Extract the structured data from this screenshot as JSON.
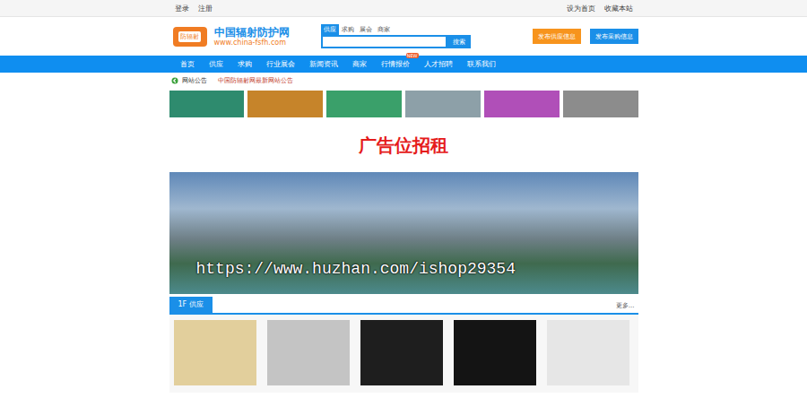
{
  "topbar": {
    "left": [
      "登录",
      "注册"
    ],
    "right": [
      "设为首页",
      "收藏本站"
    ]
  },
  "logo": {
    "badge": "防辐射",
    "title": "中国辐射防护网",
    "url": "www.china-fsfh.com"
  },
  "search": {
    "tabs": [
      {
        "label": "供应",
        "selected": true
      },
      {
        "label": "求购",
        "selected": false
      },
      {
        "label": "展会",
        "selected": false
      },
      {
        "label": "商家",
        "selected": false
      }
    ],
    "placeholder": "",
    "button": "搜索"
  },
  "actions": [
    {
      "label": "发布供应信息",
      "color": "#f7941d"
    },
    {
      "label": "发布采购信息",
      "color": "#1a8fe8"
    }
  ],
  "nav": [
    {
      "label": "首页"
    },
    {
      "label": "供应"
    },
    {
      "label": "求购"
    },
    {
      "label": "行业展会"
    },
    {
      "label": "新闻资讯"
    },
    {
      "label": "商家"
    },
    {
      "label": "行情报价",
      "badge": "NEW"
    },
    {
      "label": "人才招聘"
    },
    {
      "label": "联系我们"
    }
  ],
  "notice": {
    "label": "网站公告",
    "text": "中国防辐射网最新网站公告"
  },
  "ads": [
    {
      "color": "#2e8b6e"
    },
    {
      "color": "#c6842a"
    },
    {
      "color": "#3aa06a"
    },
    {
      "color": "#8da0a8"
    },
    {
      "color": "#b04fb8"
    },
    {
      "color": "#8c8c8c"
    }
  ],
  "promo": "广告位招租",
  "watermark": "https://www.huzhan.com/ishop29354",
  "section": {
    "floor": "1F",
    "title": "供应",
    "more": "更多..."
  },
  "products": [
    {
      "color": "#e2cf9c"
    },
    {
      "color": "#c4c4c4"
    },
    {
      "color": "#1e1e1e"
    },
    {
      "color": "#141414"
    },
    {
      "color": "#e6e6e6"
    }
  ]
}
